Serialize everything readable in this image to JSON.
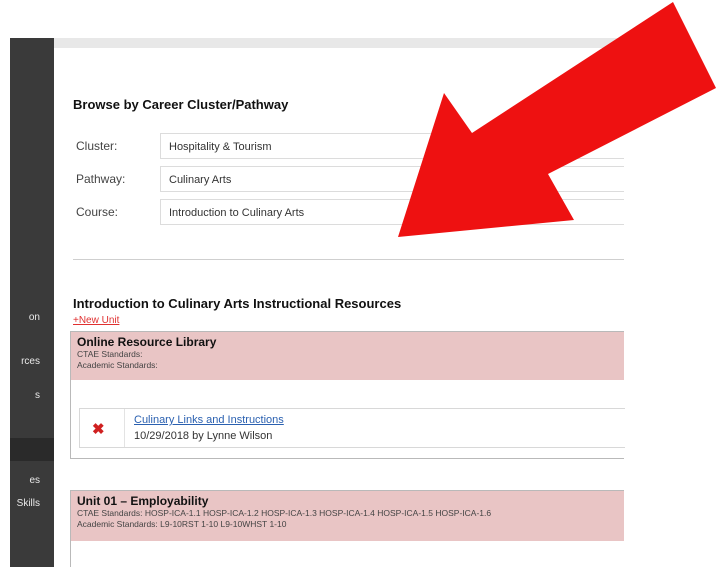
{
  "sidebar": {
    "items": [
      {
        "label": "on"
      },
      {
        "label": "rces"
      },
      {
        "label": "s"
      },
      {
        "label": "es"
      },
      {
        "label": "Skills"
      }
    ]
  },
  "browse": {
    "title": "Browse by Career Cluster/Pathway",
    "cluster_label": "Cluster:",
    "cluster_value": "Hospitality & Tourism",
    "pathway_label": "Pathway:",
    "pathway_value": "Culinary Arts",
    "course_label": "Course:",
    "course_value": "Introduction to Culinary Arts"
  },
  "resources": {
    "title": "Introduction to Culinary Arts Instructional Resources",
    "new_unit": "+New Unit",
    "units": [
      {
        "title": "Online Resource Library",
        "ctae": "CTAE Standards:",
        "academic": "Academic Standards:",
        "items": [
          {
            "link": "Culinary Links and Instructions",
            "meta": "10/29/2018 by Lynne Wilson"
          }
        ]
      },
      {
        "title": "Unit 01 – Employability",
        "ctae": "CTAE Standards: HOSP-ICA-1.1 HOSP-ICA-1.2 HOSP-ICA-1.3 HOSP-ICA-1.4 HOSP-ICA-1.5 HOSP-ICA-1.6",
        "academic": "Academic Standards: L9-10RST 1-10 L9-10WHST 1-10"
      }
    ]
  },
  "colors": {
    "arrow": "#ee1111",
    "unit_header": "#e9c5c5",
    "sidebar": "#3a3a3a",
    "delete_icon": "#d02020"
  },
  "icons": {
    "delete": "close-icon",
    "annotation": "red-arrow-icon"
  }
}
